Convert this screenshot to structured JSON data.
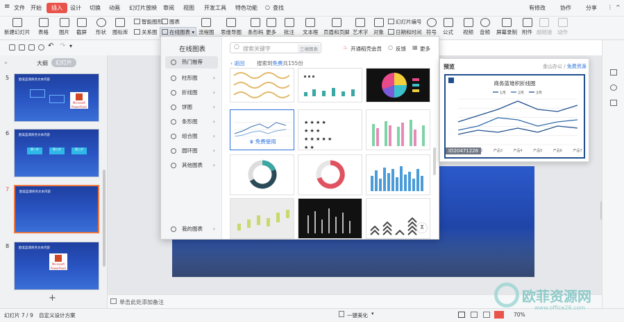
{
  "menubar": {
    "file": "文件",
    "tabs": [
      "开始",
      "插入",
      "设计",
      "切换",
      "动画",
      "幻灯片放映",
      "审阅",
      "视图",
      "开发工具",
      "特色功能"
    ],
    "search": "查找",
    "right": [
      "有修改",
      "协作",
      "分享"
    ]
  },
  "ribbon": {
    "items": [
      "新建幻灯片",
      "表格",
      "图片",
      "截屏",
      "形状",
      "图标库",
      "思维导图",
      "条形码",
      "更多",
      "批注",
      "文本框",
      "页眉和页脚",
      "艺术字",
      "对象",
      "符号",
      "公式",
      "视频",
      "音频",
      "屏幕录制",
      "附件",
      "超链接",
      "动作"
    ],
    "small": {
      "smart": "智能图形",
      "chart": "图表",
      "relation": "关系图",
      "online_chart": "在线图表",
      "flowchart": "流程图",
      "slide_num": "幻灯片编号",
      "datetime": "日期和时间"
    }
  },
  "leftpanel": {
    "tab_outline": "大纲",
    "tab_slides": "幻灯片",
    "slides": [
      {
        "num": "5",
        "title": "欧美蓝调商务文本内容",
        "badge": "Microsoft PowerPoint"
      },
      {
        "num": "6",
        "title": "欧美蓝调商务文本内容",
        "labels": [
          "第一步",
          "第二步",
          "第三步"
        ]
      },
      {
        "num": "7",
        "title": "欧美蓝调商务文本内容"
      },
      {
        "num": "8",
        "title": "欧美蓝调商务文本内容",
        "badge": "Microsoft PowerPoint"
      }
    ],
    "add": "+"
  },
  "popup": {
    "title": "在线图表",
    "search_placeholder": "搜索关键字",
    "search_tag": "三维图表",
    "vip": "开通稻壳会员",
    "feedback": "反馈",
    "more": "更多",
    "back": "返回",
    "result_prefix": "搜索到",
    "result_free": "免费",
    "result_suffix": "共155份",
    "categories": [
      "热门推荐",
      "柱形图",
      "折线图",
      "饼图",
      "条形图",
      "组合图",
      "圆环图",
      "其他图表"
    ],
    "my_charts": "我的图表",
    "free_use": "免费使用"
  },
  "preview": {
    "label": "预览",
    "source": "金山办公",
    "free": "免费资源",
    "chart_title": "商务蓝堆积折线图",
    "id": "ID20471226"
  },
  "chart_data": {
    "type": "line",
    "title": "商务蓝堆积折线图",
    "categories": [
      "产品1",
      "产品2",
      "产品3",
      "产品4",
      "产品5",
      "产品6",
      "产品7"
    ],
    "series": [
      {
        "name": "1月",
        "values": [
          5,
          7,
          6,
          8,
          6,
          9,
          8
        ]
      },
      {
        "name": "2月",
        "values": [
          7,
          9,
          13,
          12,
          9,
          11,
          12
        ]
      },
      {
        "name": "3月",
        "values": [
          11,
          14,
          17,
          21,
          17,
          16,
          19
        ]
      }
    ],
    "ylim": [
      0,
      22
    ],
    "grid": true,
    "legend": "top"
  },
  "notes": "单击此处添加备注",
  "status": {
    "slide_info": "幻灯片 7 / 9",
    "theme": "自定义设计方案",
    "beautify": "一键美化",
    "zoom": "70%"
  },
  "colors": {
    "accent": "#e8534a",
    "link": "#2a6fdb",
    "chart_line": "#1f4e8c"
  }
}
